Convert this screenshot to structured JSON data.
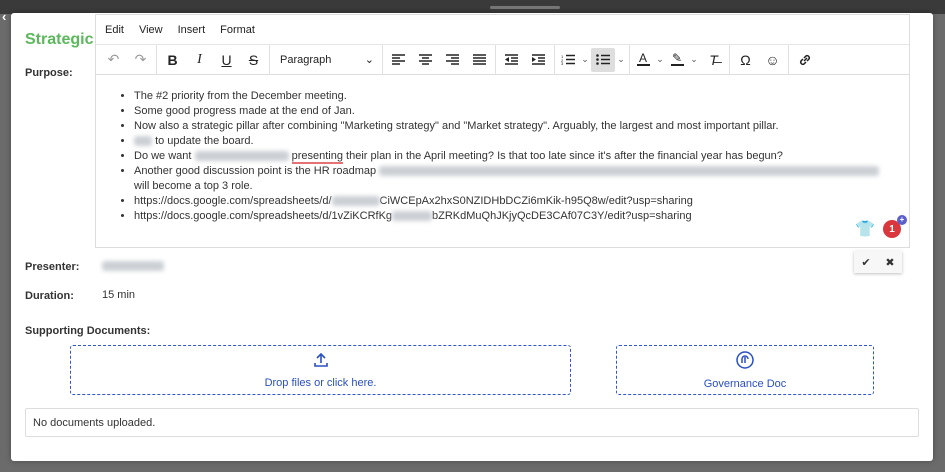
{
  "modal": {
    "title": "Strategic ",
    "labels": {
      "purpose": "Purpose:",
      "presenter": "Presenter:",
      "duration": "Duration:",
      "supporting_docs": "Supporting Documents:"
    },
    "duration_value": "15 min"
  },
  "editor": {
    "menu": [
      "Edit",
      "View",
      "Insert",
      "Format"
    ],
    "block_format": "Paragraph",
    "toolbar_icons": [
      "undo-icon",
      "redo-icon",
      "bold-icon",
      "italic-icon",
      "underline-icon",
      "strikethrough-icon",
      "align-left-icon",
      "align-center-icon",
      "align-right-icon",
      "align-justify-icon",
      "outdent-icon",
      "indent-icon",
      "numbered-list-icon",
      "bullet-list-icon",
      "text-color-icon",
      "highlight-icon",
      "clear-format-icon",
      "special-char-icon",
      "emoji-icon",
      "link-icon"
    ],
    "bullets": {
      "b1": "The #2 priority from the December meeting.",
      "b2": "Some good progress made at the end of Jan.",
      "b3": "Now also a strategic pillar after combining \"Marketing strategy\" and \"Market strategy\". Arguably, the largest and most important pillar.",
      "b4": "to update the board.",
      "b5a": "Do we want",
      "b5b": "presenting",
      "b5c": "their plan in the April meeting? Is that too late since it's after the financial year has begun?",
      "b6a": "Another good discussion point is the HR roadmap",
      "b6b": "will become a top 3 role.",
      "b7a": "https://docs.google.com/spreadsheets/d/",
      "b7b": "CiWCEpAx2hxS0NZIDHbDCZi6mKik-h95Q8w/edit?usp=sharing",
      "b8a": "https://docs.google.com/spreadsheets/d/1vZiKCRfKg",
      "b8b": "bZRKdMuQhJKjyQcDE3CAf07C3Y/edit?usp=sharing"
    },
    "badge_count": "1",
    "badge_plus": "+"
  },
  "uploads": {
    "dropzone_label": "Drop files or click here.",
    "governance_label": "Governance Doc",
    "empty_text": "No documents uploaded."
  },
  "colors": {
    "title": "#5cb85c",
    "link_blue": "#2a4fbf",
    "badge_red": "#d9363e"
  }
}
